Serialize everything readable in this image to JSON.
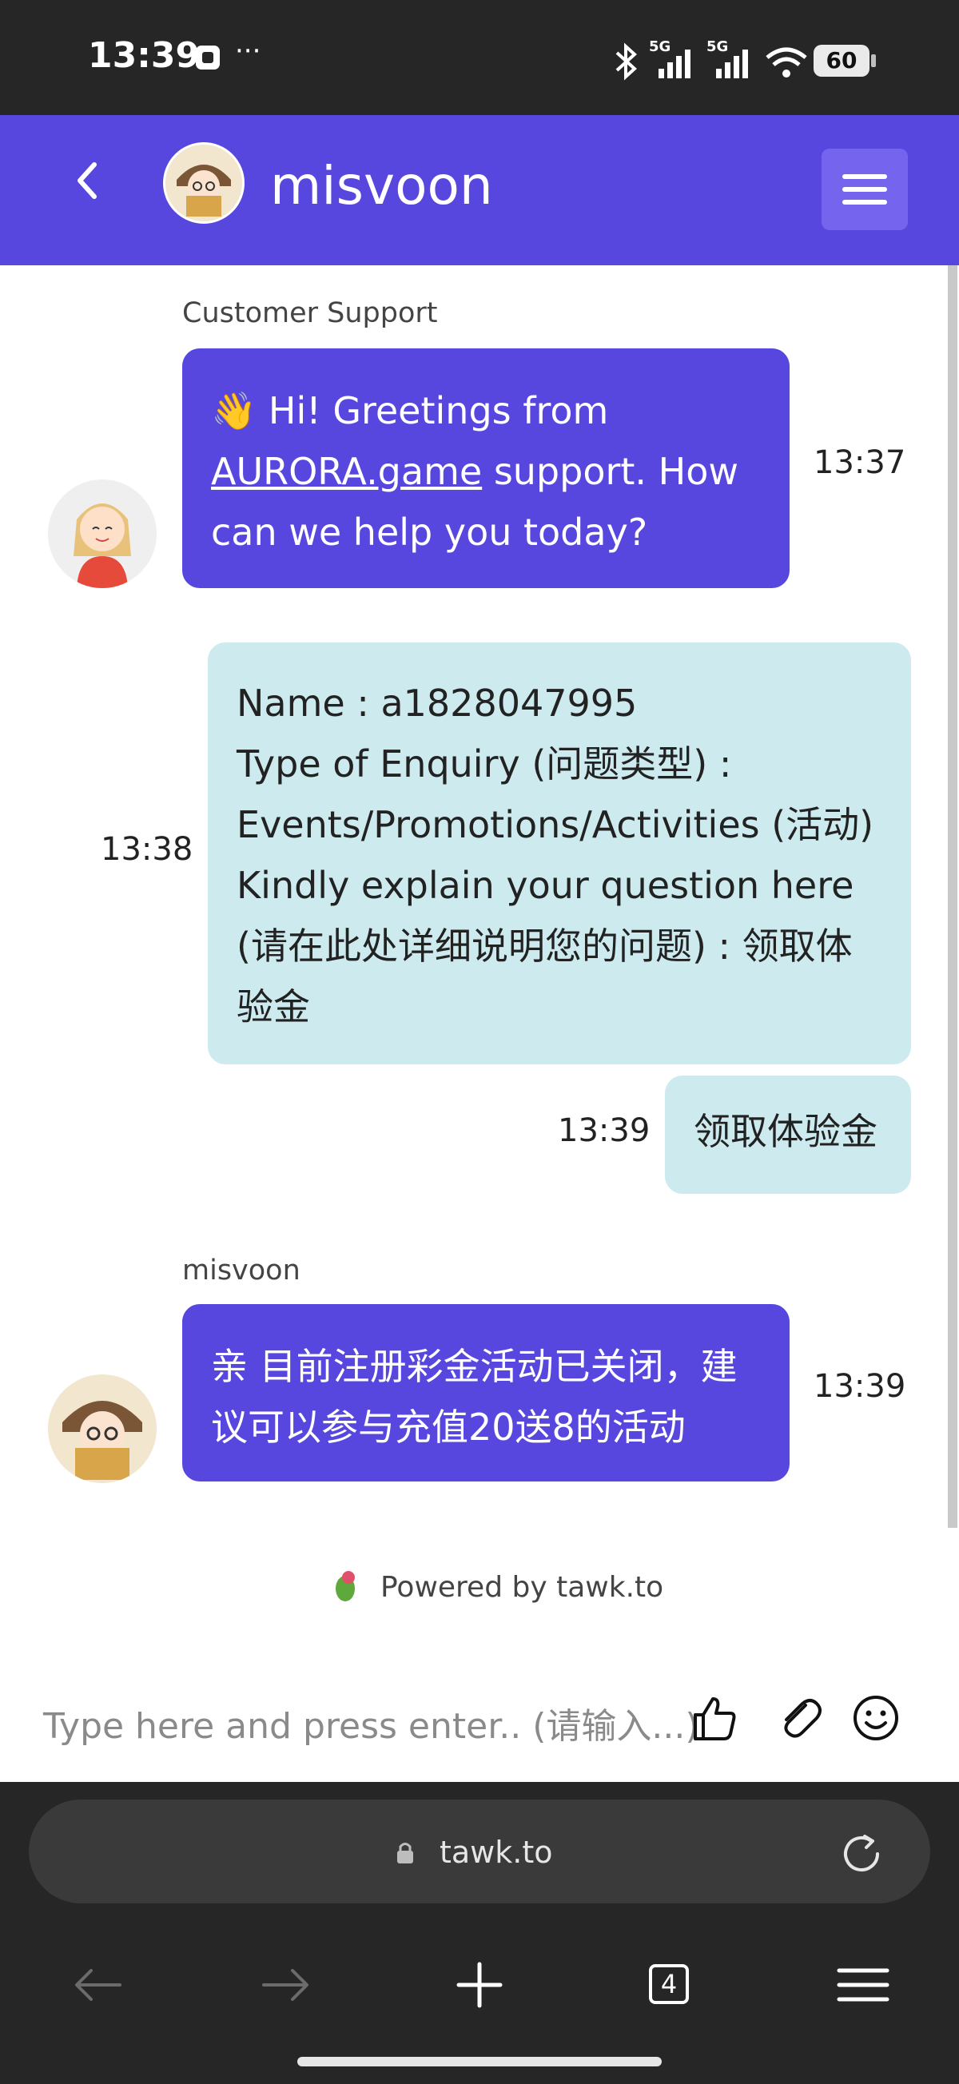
{
  "status_bar": {
    "time": "13:39",
    "battery": "60",
    "signal_1": "5G",
    "signal_2": "5G"
  },
  "header": {
    "title": "misvoon"
  },
  "messages": [
    {
      "sender": "Customer Support",
      "emoji": "👋",
      "text_before_link": "Hi! Greetings from",
      "link": "AURORA.game",
      "text_after_link": "support. How can we help you today?",
      "time": "13:37"
    },
    {
      "lines": [
        "Name : a1828047995",
        "Type of Enquiry (问题类型) :",
        "Events/Promotions/Activities (活动)",
        "Kindly explain your question here (请在此处详细说明您的问题) : 领取体验金"
      ],
      "time": "13:38"
    },
    {
      "text": "领取体验金",
      "time": "13:39"
    },
    {
      "sender": "misvoon",
      "text": "亲 目前注册彩金活动已关闭，建议可以参与充值20送8的活动",
      "time": "13:39"
    }
  ],
  "footer": {
    "powered_by": "Powered by tawk.to"
  },
  "composer": {
    "placeholder": "Type here and press enter.. (请输入...)"
  },
  "browser": {
    "url": "tawk.to",
    "tab_count": "4"
  },
  "colors": {
    "primary": "#5747de",
    "user_bubble": "#cdebef",
    "system_bar": "#262626"
  }
}
